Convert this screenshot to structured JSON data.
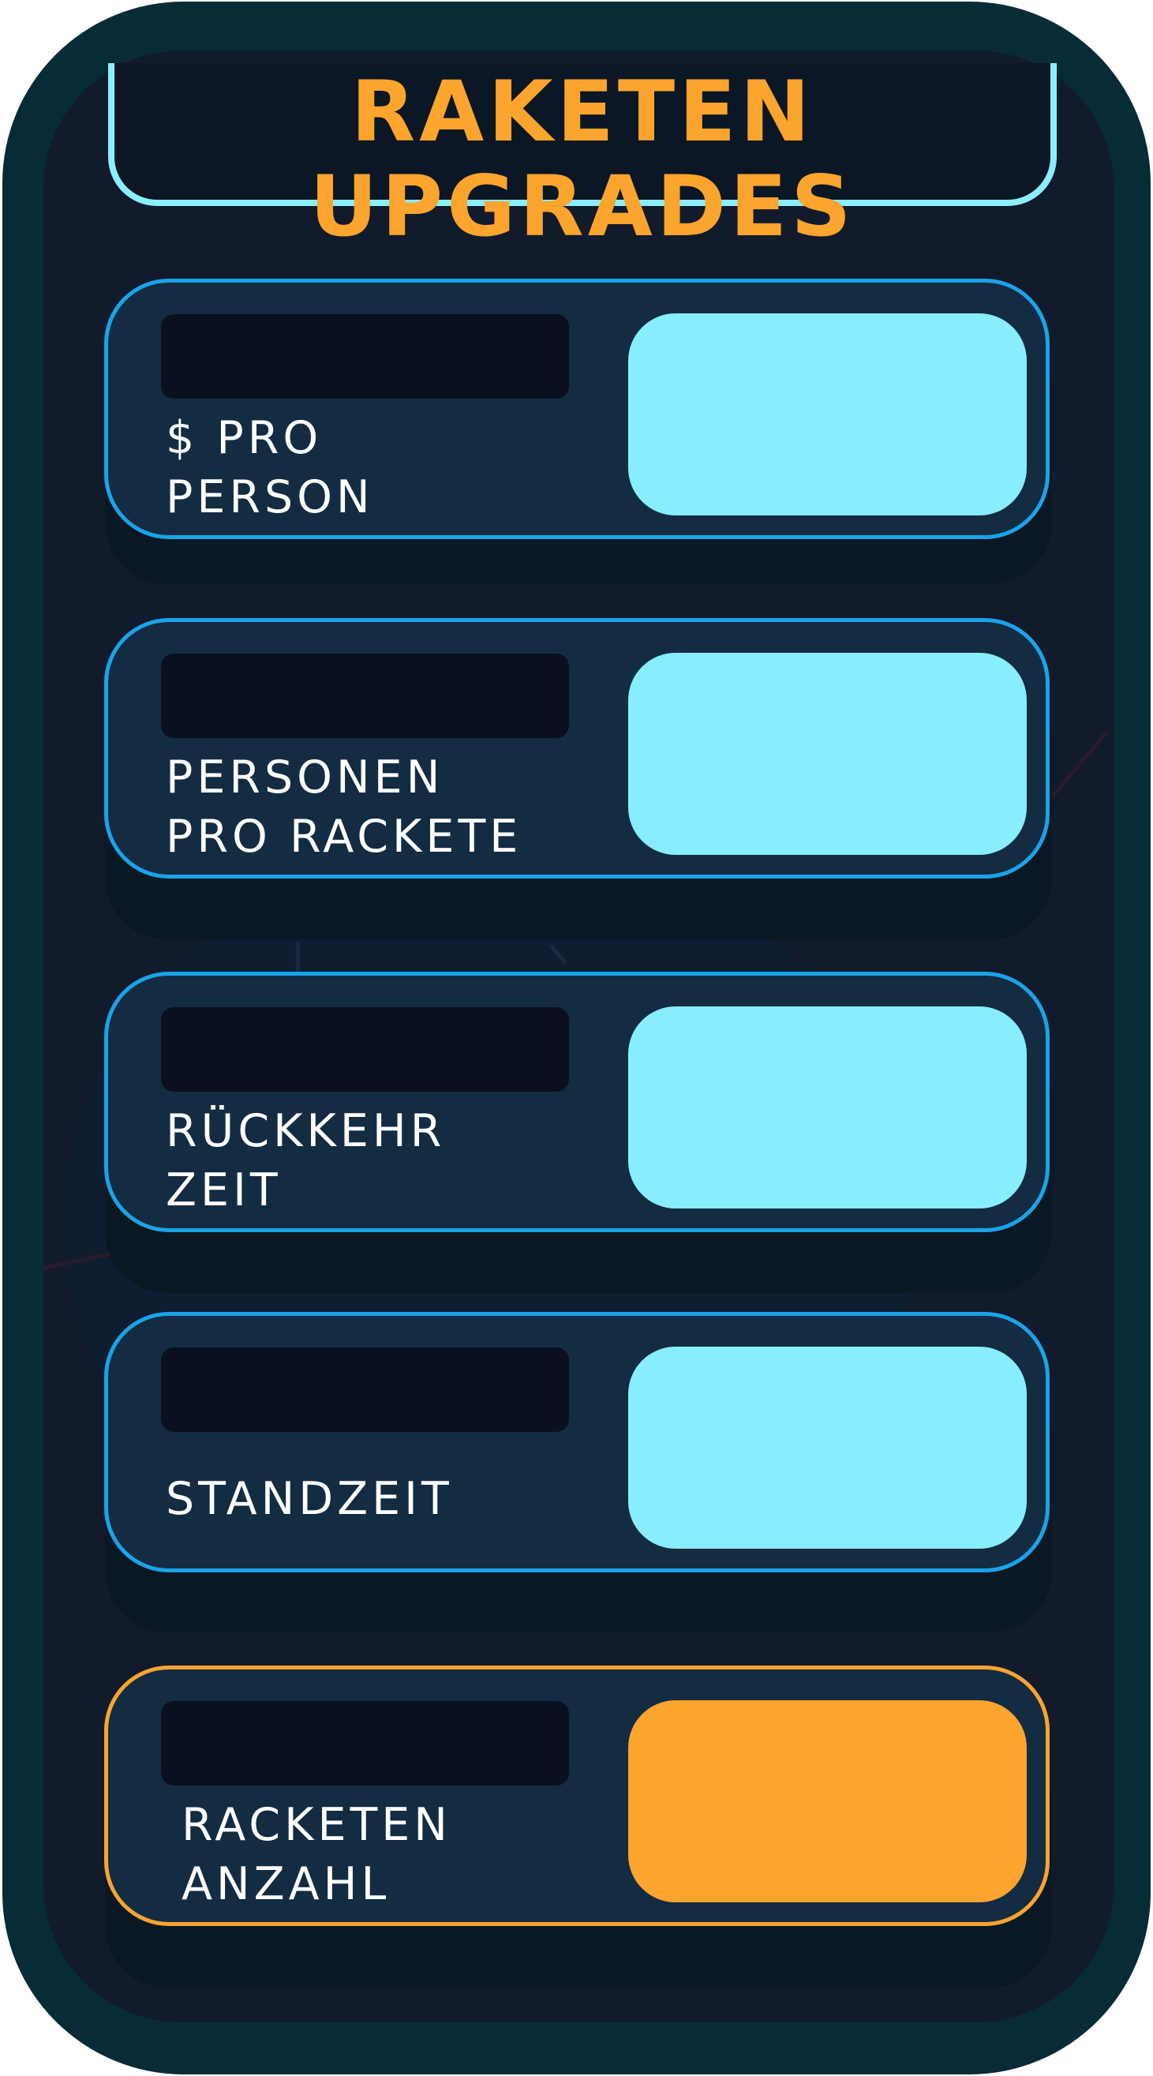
{
  "panel": {
    "title": "RAKETEN UPGRADES"
  },
  "upgrades": [
    {
      "label": "$ PRO\nPERSON",
      "accent": "#1aa3e8"
    },
    {
      "label": "PERSONEN\nPRO RACKETE",
      "accent": "#1aa3e8"
    },
    {
      "label": "RÜCKKEHR\nZEIT",
      "accent": "#1aa3e8"
    },
    {
      "label": "STANDZEIT",
      "accent": "#1aa3e8"
    },
    {
      "label": "RACKETEN\nANZAHL",
      "accent": "#f9a331"
    }
  ],
  "colors": {
    "title": "#fba42e",
    "upgrade_button": "#88edff",
    "highlight_button": "#fba42e",
    "panel_frame": "#072c36",
    "panel_bg": "#121b2b"
  }
}
